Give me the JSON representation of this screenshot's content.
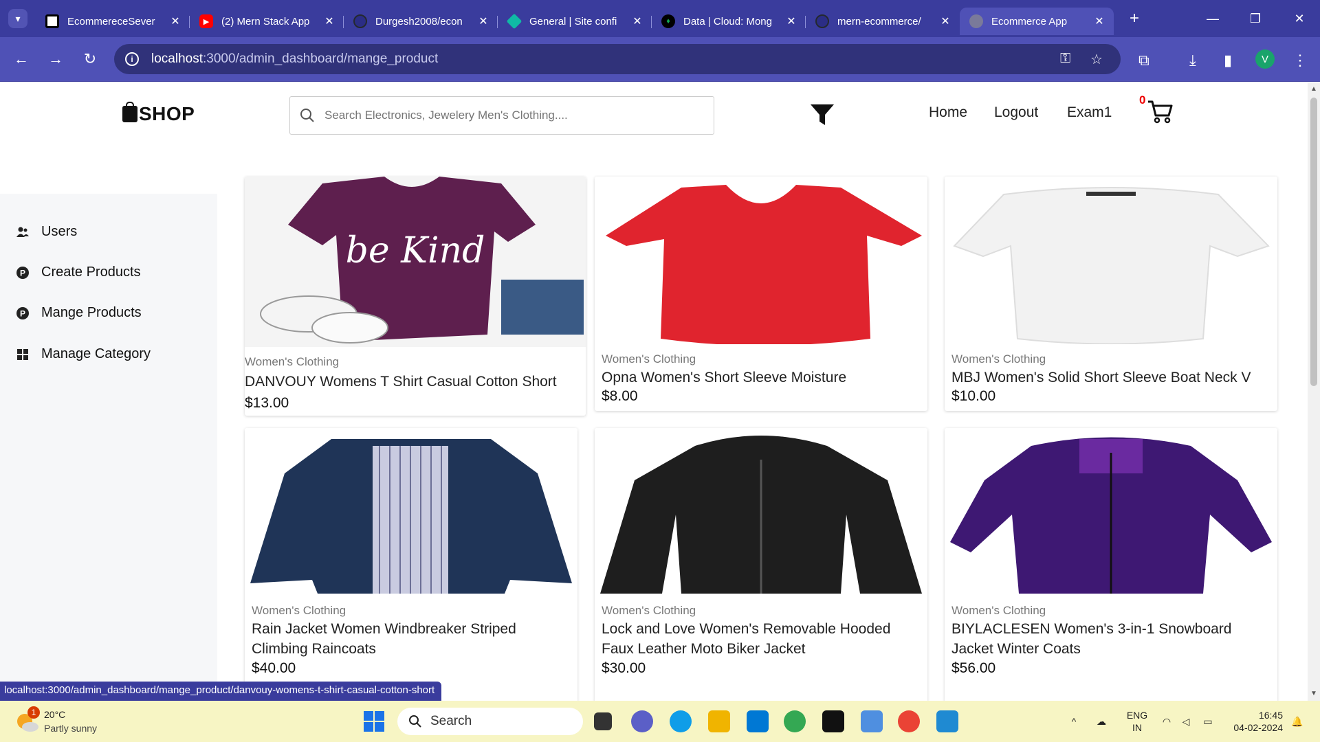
{
  "browser": {
    "tabs": [
      {
        "title": "EcommereceSever",
        "favicon_color": "#ffffff"
      },
      {
        "title": "(2) Mern Stack App",
        "favicon_color": "#ff0000"
      },
      {
        "title": "Durgesh2008/econ",
        "favicon_color": "#24292f"
      },
      {
        "title": "General | Site confi",
        "favicon_color": "#10b9a5"
      },
      {
        "title": "Data | Cloud: Mong",
        "favicon_color": "#00684a"
      },
      {
        "title": "mern-ecommerce/",
        "favicon_color": "#24292f"
      },
      {
        "title": "Ecommerce App",
        "favicon_color": "#888888",
        "active": true
      }
    ],
    "url_host": "localhost",
    "url_path": ":3000/admin_dashboard/mange_product",
    "profile_initial": "V"
  },
  "header": {
    "brand": "SHOP",
    "search_placeholder": "Search Electronics, Jewelery Men's Clothing....",
    "nav": [
      "Home",
      "Logout",
      "Exam1"
    ],
    "cart_count": "0"
  },
  "sidebar": {
    "items": [
      {
        "label": "Users",
        "icon": "users-icon"
      },
      {
        "label": "Create Products",
        "icon": "product-p-icon"
      },
      {
        "label": "Mange Products",
        "icon": "product-p-icon"
      },
      {
        "label": "Manage Category",
        "icon": "grid-icon"
      }
    ]
  },
  "products": [
    {
      "category": "Women's Clothing",
      "name": "DANVOUY Womens T Shirt Casual Cotton Short",
      "price": "$13.00",
      "image": "purple-tshirt-be-kind",
      "image_text": "be Kind",
      "color": "#5e1f4e"
    },
    {
      "category": "Women's Clothing",
      "name": "Opna Women's Short Sleeve Moisture",
      "price": "$8.00",
      "image": "red-vneck-tshirt",
      "color": "#e0242e"
    },
    {
      "category": "Women's Clothing",
      "name": "MBJ Women's Solid Short Sleeve Boat Neck V",
      "price": "$10.00",
      "image": "white-boatneck-top",
      "color": "#f2f2f2"
    },
    {
      "category": "Women's Clothing",
      "name": "Rain Jacket Women Windbreaker Striped Climbing Raincoats",
      "price": "$40.00",
      "image": "navy-rain-jacket",
      "color": "#1f3457"
    },
    {
      "category": "Women's Clothing",
      "name": "Lock and Love Women's Removable Hooded Faux Leather Moto Biker Jacket",
      "price": "$30.00",
      "image": "black-leather-jacket",
      "color": "#1e1e1e"
    },
    {
      "category": "Women's Clothing",
      "name": "BIYLACLESEN Women's 3-in-1 Snowboard Jacket Winter Coats",
      "price": "$56.00",
      "image": "purple-snowboard-jacket",
      "color": "#3e1873"
    }
  ],
  "status_url": "localhost:3000/admin_dashboard/mange_product/danvouy-womens-t-shirt-casual-cotton-short",
  "taskbar": {
    "weather_temp": "20°C",
    "weather_desc": "Partly sunny",
    "weather_badge": "1",
    "search_label": "Search",
    "lang": "ENG",
    "region": "IN",
    "time": "16:45",
    "date": "04-02-2024"
  }
}
